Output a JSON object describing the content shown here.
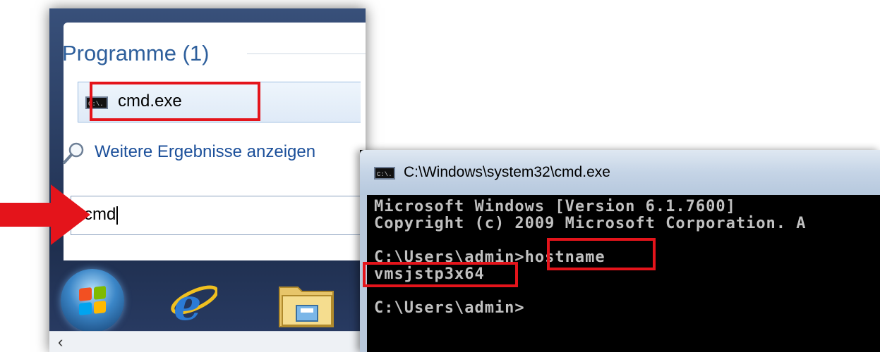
{
  "start_menu": {
    "group_title": "Programme (1)",
    "result_label": "cmd.exe",
    "result_icon": "cmd-icon",
    "more_results": "Weitere Ergebnisse anzeigen",
    "search_value": "cmd",
    "taskbar_icons": [
      "windows-start-orb",
      "internet-explorer-icon",
      "windows-explorer-icon"
    ]
  },
  "cmd_window": {
    "title": "C:\\Windows\\system32\\cmd.exe",
    "lines": [
      "Microsoft Windows [Version 6.1.7600]",
      "Copyright (c) 2009 Microsoft Corporation. A",
      "C:\\Users\\admin>hostname",
      "vmsjstp3x64",
      "C:\\Users\\admin>"
    ]
  },
  "colors": {
    "highlight": "#e4141b",
    "arrow": "#e4141b",
    "link": "#1b4f9a",
    "group_title": "#2e5f9c"
  }
}
